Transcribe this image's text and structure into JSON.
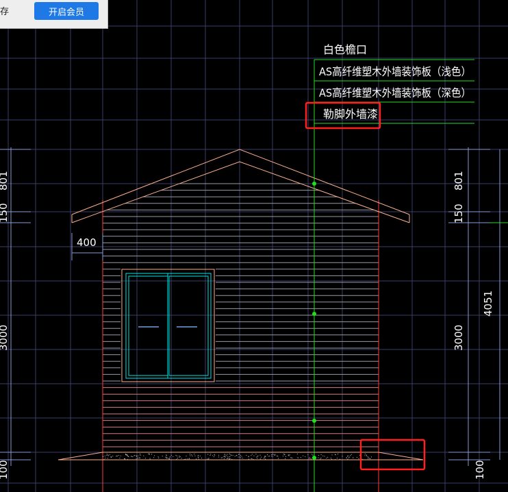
{
  "toolbar": {
    "save_fragment": "存",
    "vip_label": "开启会员"
  },
  "legend": {
    "items": [
      "白色檐口",
      "AS高纤维塑木外墙装饰板（浅色）",
      "AS高纤维塑木外墙装饰板（深色）",
      "勒脚外墙漆"
    ]
  },
  "dimensions": {
    "left": [
      "801",
      "150",
      "3000",
      "100"
    ],
    "right": [
      "801",
      "150",
      "3000",
      "100"
    ],
    "overall": "4051",
    "offset": "400"
  },
  "colors": {
    "background": "#000000",
    "grid": "#3a4068",
    "wall": "#ff3b3b",
    "roof": "#ffb090",
    "window": "#00e5e5",
    "leader": "#22dd22",
    "dimension": "#8a9ad8",
    "highlight": "#ff2020",
    "text": "#ffffff"
  }
}
